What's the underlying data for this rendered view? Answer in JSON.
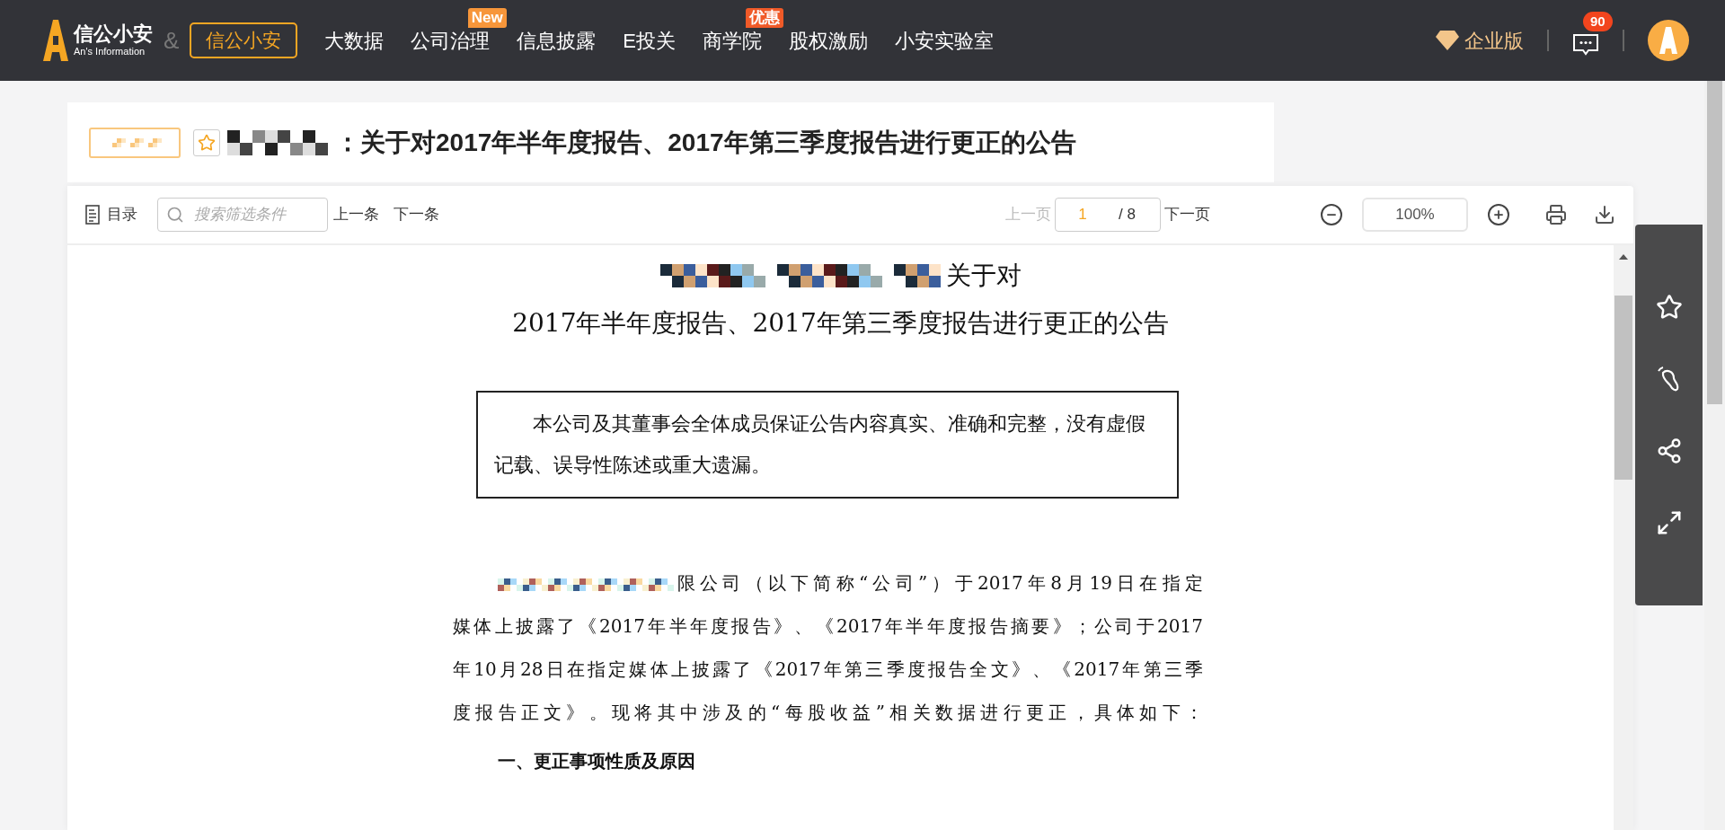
{
  "nav": {
    "logo": {
      "name": "信公小安",
      "subtitle": "An's Information"
    },
    "ampersand": "&",
    "partner_button": "信公小安",
    "items": [
      {
        "label": "大数据"
      },
      {
        "label": "公司治理",
        "badge": "New",
        "color": "#f7963a"
      },
      {
        "label": "信息披露"
      },
      {
        "label": "E投关"
      },
      {
        "label": "商学院",
        "badge": "优惠",
        "color": "#f05a28"
      },
      {
        "label": "股权激励"
      },
      {
        "label": "小安实验室"
      }
    ],
    "enterprise": "企业版",
    "message_count": "90"
  },
  "title_card": {
    "title": "：关于对2017年半年度报告、2017年第三季度报告进行更正的公告",
    "starred": false
  },
  "toolbar": {
    "contents": "目录",
    "search": {
      "placeholder": "搜索筛选条件"
    },
    "prev_item": "上一条",
    "next_item": "下一条",
    "prev_page": {
      "label": "上一页",
      "disabled": true
    },
    "page": "1",
    "page_total": "/ 8",
    "next_page": {
      "label": "下一页",
      "disabled": false
    },
    "zoom": "100%"
  },
  "document": {
    "heading_line1": "关于对",
    "heading_line2": "2017年半年度报告、2017年第三季度报告进行更正的公告",
    "notice": "本公司及其董事会全体成员保证公告内容真实、准确和完整，没有虚假记载、误导性陈述或重大遗漏。",
    "paragraph_lines": [
      "限公司（以下简称“公司”）于2017年8月19日在指定",
      "媒体上披露了《2017年半年度报告》、《2017年半年度报告摘要》；公司于2017",
      "年10月28日在指定媒体上披露了《2017年第三季度报告全文》、《2017年第三季",
      "度报告正文》。现将其中涉及的“每股收益”相关数据进行更正，具体如下："
    ],
    "section_heading": "一、更正事项性质及原因"
  }
}
